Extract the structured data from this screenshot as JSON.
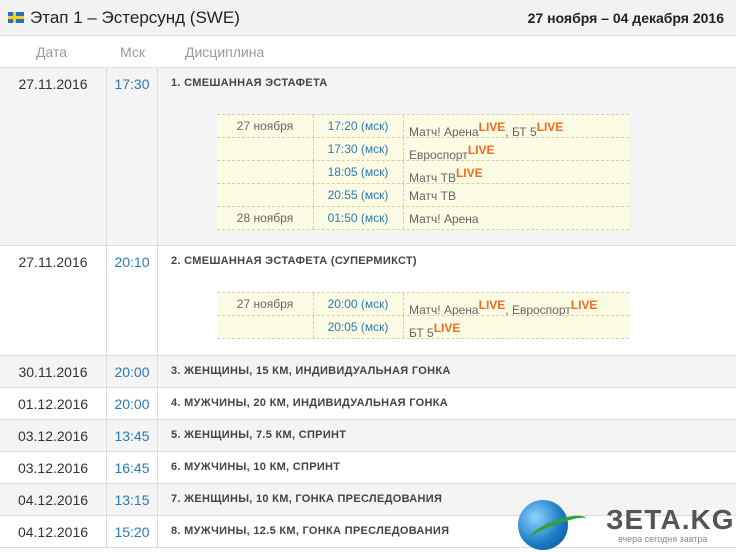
{
  "header": {
    "title": "Этап 1 – Эстерсунд (SWE)",
    "dates": "27 ноября – 04 декабря 2016"
  },
  "columns": [
    "Дата",
    "Мск",
    "Дисциплина"
  ],
  "events": [
    {
      "date": "27.11.2016",
      "time": "17:30",
      "title": "1. СМЕШАННАЯ ЭСТАФЕТА",
      "broadcasts": [
        {
          "date": "27 ноября",
          "time": "17:20 (мск)",
          "channels": [
            {
              "name": "Матч! Арена",
              "live": "LIVE"
            },
            {
              "name": ", БТ 5",
              "live": "LIVE"
            }
          ]
        },
        {
          "date": "",
          "time": "17:30 (мск)",
          "channels": [
            {
              "name": "Евроспорт",
              "live": "LIVE"
            }
          ]
        },
        {
          "date": "",
          "time": "18:05 (мск)",
          "channels": [
            {
              "name": "Матч ТВ",
              "live": "LIVE"
            }
          ]
        },
        {
          "date": "",
          "time": "20:55 (мск)",
          "channels": [
            {
              "name": "Матч ТВ",
              "live": ""
            }
          ]
        },
        {
          "date": "28 ноября",
          "time": "01:50 (мск)",
          "channels": [
            {
              "name": "Матч! Арена",
              "live": ""
            }
          ]
        }
      ]
    },
    {
      "date": "27.11.2016",
      "time": "20:10",
      "title": "2. СМЕШАННАЯ ЭСТАФЕТА (СУПЕРМИКСТ)",
      "broadcasts": [
        {
          "date": "27 ноября",
          "time": "20:00 (мск)",
          "channels": [
            {
              "name": "Матч! Арена",
              "live": "LIVE"
            },
            {
              "name": ", Евроспорт",
              "live": "LIVE"
            }
          ]
        },
        {
          "date": "",
          "time": "20:05 (мск)",
          "channels": [
            {
              "name": "БТ 5",
              "live": "LIVE"
            }
          ]
        }
      ]
    },
    {
      "date": "30.11.2016",
      "time": "20:00",
      "title": "3. ЖЕНЩИНЫ, 15 КМ, ИНДИВИДУАЛЬНАЯ ГОНКА",
      "broadcasts": []
    },
    {
      "date": "01.12.2016",
      "time": "20:00",
      "title": "4. МУЖЧИНЫ, 20 КМ, ИНДИВИДУАЛЬНАЯ ГОНКА",
      "broadcasts": []
    },
    {
      "date": "03.12.2016",
      "time": "13:45",
      "title": "5. ЖЕНЩИНЫ, 7.5 КМ, СПРИНТ",
      "broadcasts": []
    },
    {
      "date": "03.12.2016",
      "time": "16:45",
      "title": "6. МУЖЧИНЫ, 10 КМ, СПРИНТ",
      "broadcasts": []
    },
    {
      "date": "04.12.2016",
      "time": "13:15",
      "title": "7. ЖЕНЩИНЫ, 10 КМ, ГОНКА ПРЕСЛЕДОВАНИЯ",
      "broadcasts": []
    },
    {
      "date": "04.12.2016",
      "time": "15:20",
      "title": "8. МУЖЧИНЫ, 12.5 КМ, ГОНКА ПРЕСЛЕДОВАНИЯ",
      "broadcasts": []
    }
  ],
  "watermark": {
    "brand": "ЗЕТА.KG",
    "tagline": "вчера сегодня завтра",
    "icon": "globe-icon"
  },
  "colors": {
    "time": "#2a7ab8",
    "live": "#f26b21",
    "broadcast_bg": "#fcfbe4",
    "header_bg": "#f2f2f2"
  }
}
